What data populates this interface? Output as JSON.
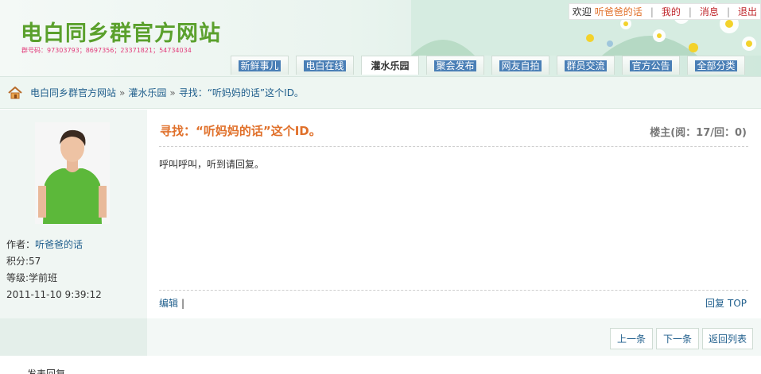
{
  "header": {
    "site_title": "电白同乡群官方网站",
    "group_ids": "群号码：97303793；8697356；23371821；54734034",
    "user_bar": {
      "welcome": "欢迎",
      "username": "听爸爸的话",
      "mine": "我的",
      "messages": "消息",
      "logout": "退出"
    },
    "nav": [
      {
        "label": "新鲜事儿"
      },
      {
        "label": "电白在线"
      },
      {
        "label": "灌水乐园"
      },
      {
        "label": "聚会发布"
      },
      {
        "label": "网友自拍"
      },
      {
        "label": "群员交流"
      },
      {
        "label": "官方公告"
      },
      {
        "label": "全部分类"
      }
    ]
  },
  "breadcrumb": {
    "home": "电白同乡群官方网站",
    "section": "灌水乐园",
    "current": "寻找：“听妈妈的话”这个ID。"
  },
  "author": {
    "author_label": "作者：",
    "author_name": "听爸爸的话",
    "points": "积分:57",
    "level": "等级:学前班",
    "time": "2011-11-10 9:39:12"
  },
  "post": {
    "title": "寻找：“听妈妈的话”这个ID。",
    "meta": "楼主(阅：17/回：0)",
    "body": "呼叫呼叫，听到请回复。",
    "edit": "编辑",
    "edit_sep": "|",
    "reply": "回复",
    "top": "TOP"
  },
  "actions": {
    "prev": "上一条",
    "next": "下一条",
    "back": "返回列表"
  },
  "footer_peek": "…发表回复",
  "colors": {
    "title_green": "#5aa02c",
    "accent_orange": "#e0702a",
    "link_blue": "#1f5e8c",
    "nav_blue": "#4a7fb6"
  }
}
